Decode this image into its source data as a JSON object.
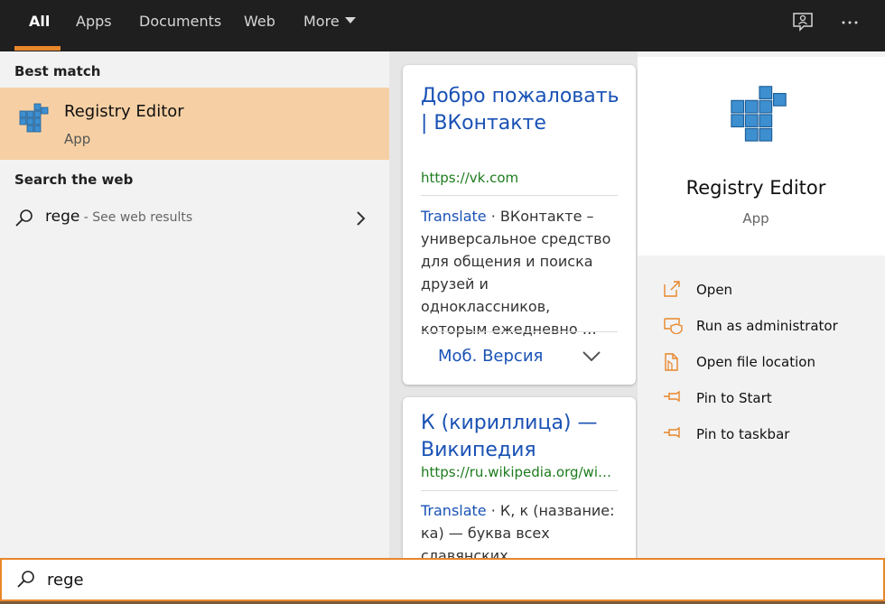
{
  "tabs": [
    {
      "label": "All"
    },
    {
      "label": "Apps"
    },
    {
      "label": "Documents"
    },
    {
      "label": "Web"
    },
    {
      "label": "More"
    }
  ],
  "accent_color": "#e8862a",
  "left": {
    "best_match_heading": "Best match",
    "best_match": {
      "title": "Registry Editor",
      "subtitle": "App"
    },
    "search_web_heading": "Search the web",
    "web_result": {
      "query": "rege",
      "hint": " - See web results"
    }
  },
  "cards": [
    {
      "title": "Добро пожаловать | ВКонтакте",
      "url": "https://vk.com",
      "translate": "Translate",
      "snippet": " · ВКонтакте – универсальное средство для общения и поиска друзей и одноклассников, которым ежедневно …",
      "footer_link": "Моб. Версия"
    },
    {
      "title": "К (кириллица) — Википедия",
      "url": "https://ru.wikipedia.org/wi…",
      "translate": "Translate",
      "snippet": " · К, к (название: ка) — буква всех славянских"
    }
  ],
  "preview": {
    "title": "Registry Editor",
    "subtitle": "App",
    "actions": [
      {
        "label": "Open",
        "icon": "open-icon"
      },
      {
        "label": "Run as administrator",
        "icon": "shield-icon"
      },
      {
        "label": "Open file location",
        "icon": "file-location-icon"
      },
      {
        "label": "Pin to Start",
        "icon": "pin-icon"
      },
      {
        "label": "Pin to taskbar",
        "icon": "pin-icon"
      }
    ]
  },
  "search": {
    "value": "rege"
  }
}
